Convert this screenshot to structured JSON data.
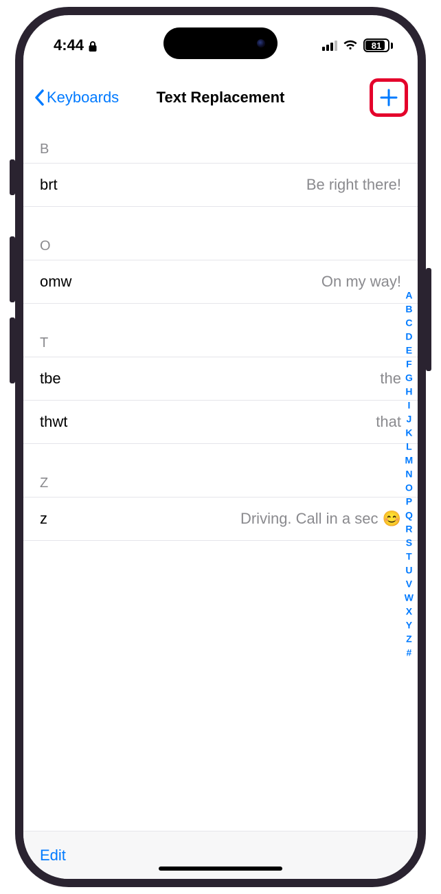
{
  "status": {
    "time": "4:44",
    "battery_pct": "81"
  },
  "nav": {
    "back_label": "Keyboards",
    "title": "Text Replacement"
  },
  "sections": [
    {
      "letter": "B",
      "rows": [
        {
          "shortcut": "brt",
          "phrase": "Be right there!"
        }
      ]
    },
    {
      "letter": "O",
      "rows": [
        {
          "shortcut": "omw",
          "phrase": "On my way!"
        }
      ]
    },
    {
      "letter": "T",
      "rows": [
        {
          "shortcut": "tbe",
          "phrase": "the"
        },
        {
          "shortcut": "thwt",
          "phrase": "that"
        }
      ]
    },
    {
      "letter": "Z",
      "rows": [
        {
          "shortcut": "z",
          "phrase": "Driving. Call in a sec 😊"
        }
      ]
    }
  ],
  "alpha_index": [
    "A",
    "B",
    "C",
    "D",
    "E",
    "F",
    "G",
    "H",
    "I",
    "J",
    "K",
    "L",
    "M",
    "N",
    "O",
    "P",
    "Q",
    "R",
    "S",
    "T",
    "U",
    "V",
    "W",
    "X",
    "Y",
    "Z",
    "#"
  ],
  "toolbar": {
    "edit_label": "Edit"
  }
}
